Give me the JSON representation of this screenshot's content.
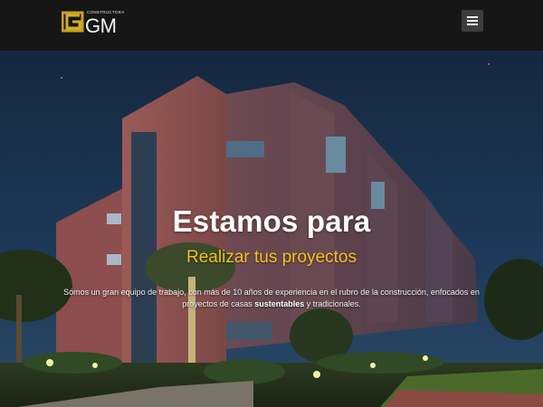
{
  "header": {
    "logo": {
      "small_text": "CONSTRUCTORA",
      "text": "GM"
    },
    "menu_icon": "hamburger-menu-icon"
  },
  "hero": {
    "title": "Estamos para",
    "subtitle": "Realizar tus proyectos",
    "description": {
      "part1": "Sómos un gran equipo de trabajo, con más de 10 años de experiencia en el rubro de la construcción, enfocados en proyectos de casas ",
      "bold1": "sustentables",
      "part2": " y tradicionales."
    }
  },
  "colors": {
    "header_bg": "#161616",
    "accent_yellow": "#f4c21d",
    "sky": "#1b3150",
    "building": "#8a5050"
  }
}
